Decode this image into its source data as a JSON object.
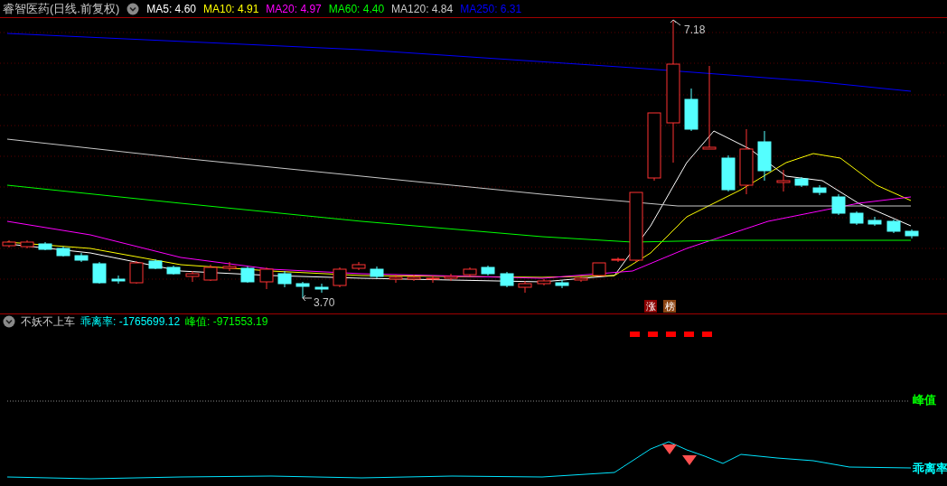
{
  "header": {
    "title": "睿智医药(日线.前复权)",
    "ma": [
      {
        "label": "MA5: 4.60",
        "color": "#ffffff"
      },
      {
        "label": "MA10: 4.91",
        "color": "#ffff00"
      },
      {
        "label": "MA20: 4.97",
        "color": "#ff00ff"
      },
      {
        "label": "MA60: 4.40",
        "color": "#00ff00"
      },
      {
        "label": "MA120: 4.84",
        "color": "#c8c8c8"
      },
      {
        "label": "MA250: 6.31",
        "color": "#0000ff"
      }
    ]
  },
  "price_labels": [
    {
      "text": "7.18"
    },
    {
      "text": "3.70"
    }
  ],
  "badges": [
    {
      "text": "涨",
      "color": "#8b0000"
    },
    {
      "text": "榜",
      "color": "#8b4513"
    }
  ],
  "indicator": {
    "name": "不妖不上车",
    "values": [
      {
        "text": "乖离率: -1765699.12",
        "color": "#00ffff"
      },
      {
        "text": "峰值: -971553.19",
        "color": "#00ff00"
      }
    ]
  },
  "line_labels": [
    {
      "text": "峰值",
      "color": "#00ff00"
    },
    {
      "text": "乖离率",
      "color": "#00ffff"
    }
  ]
}
